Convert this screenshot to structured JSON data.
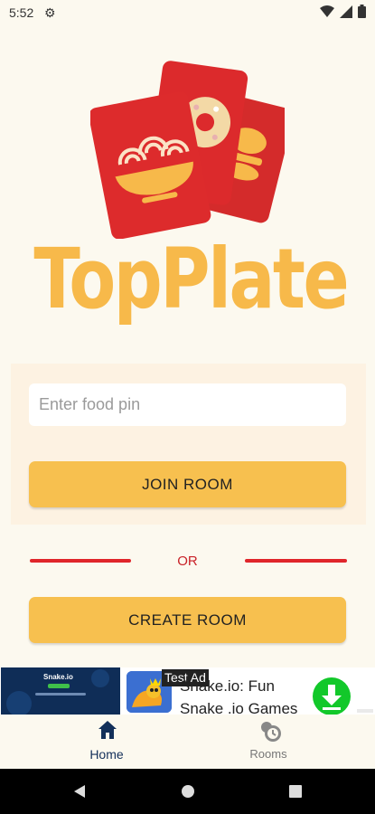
{
  "status_bar": {
    "time": "5:52",
    "settings_icon": "gear-icon",
    "wifi_icon": "wifi-icon",
    "signal_icon": "signal-icon",
    "battery_icon": "battery-icon"
  },
  "app": {
    "name": "TopPlate",
    "brand_color": "#f7b94a",
    "accent_red": "#dc2a2c"
  },
  "join": {
    "pin_placeholder": "Enter food pin",
    "pin_value": "",
    "join_label": "JOIN ROOM"
  },
  "divider": {
    "or_label": "OR"
  },
  "create": {
    "create_label": "CREATE ROOM"
  },
  "ad": {
    "badge": "Test Ad",
    "title": "Snake.io: Fun Snake .io Games",
    "thumb_title": "Snake.io",
    "download_icon": "download-icon"
  },
  "nav": {
    "home_label": "Home",
    "rooms_label": "Rooms"
  },
  "system_nav": {
    "back_icon": "back-icon",
    "home_icon": "home-circle-icon",
    "recents_icon": "recents-icon"
  }
}
